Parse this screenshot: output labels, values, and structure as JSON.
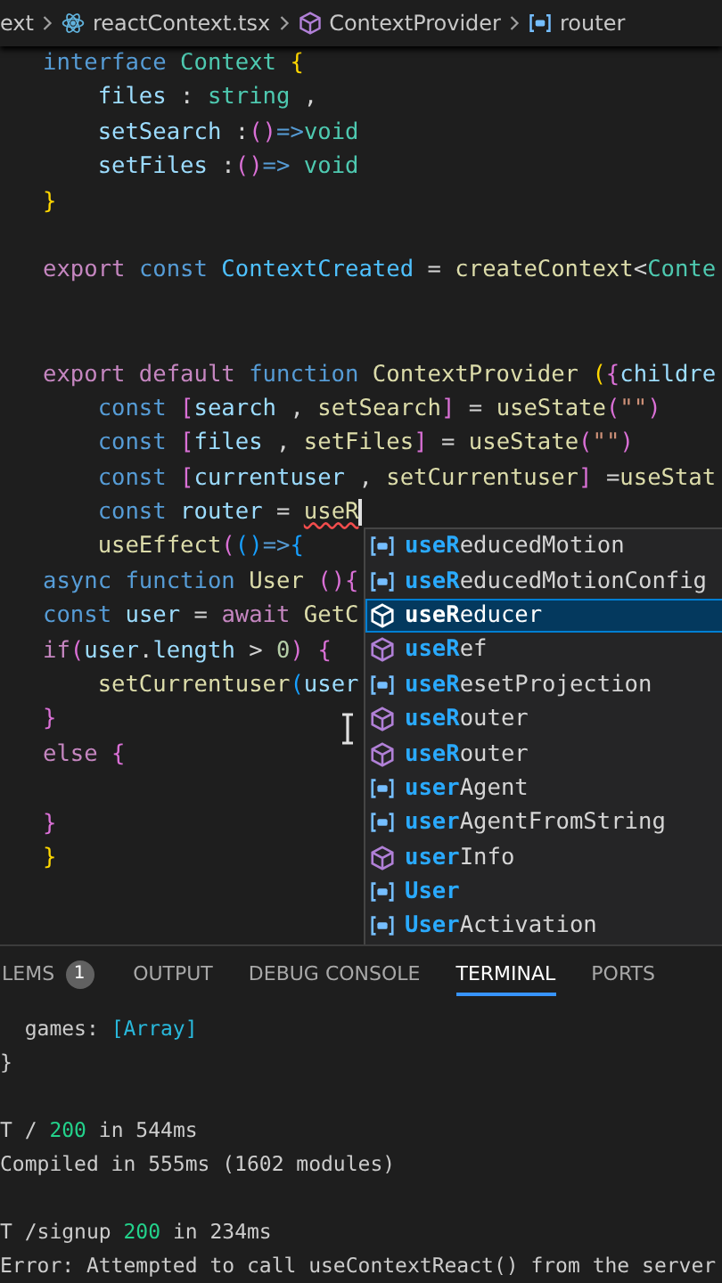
{
  "breadcrumb": [
    {
      "text": "ext",
      "kind": "plain"
    },
    {
      "text": "reactContext.tsx",
      "kind": "file"
    },
    {
      "text": "ContextProvider",
      "kind": "cube"
    },
    {
      "text": "router",
      "kind": "variable"
    }
  ],
  "code_lines": [
    {
      "tokens": [
        {
          "text": "interface ",
          "kind": "kw"
        },
        {
          "text": "Context ",
          "kind": "type"
        },
        {
          "text": "{",
          "kind": "b1"
        }
      ]
    },
    {
      "tokens": [
        {
          "text": "    files",
          "kind": "var"
        },
        {
          "text": " : ",
          "kind": "p"
        },
        {
          "text": "string",
          "kind": "type"
        },
        {
          "text": " ,",
          "kind": "p"
        }
      ]
    },
    {
      "tokens": [
        {
          "text": "    setSearch",
          "kind": "var"
        },
        {
          "text": " :",
          "kind": "p"
        },
        {
          "text": "()",
          "kind": "b2"
        },
        {
          "text": "=>",
          "kind": "kw"
        },
        {
          "text": "void",
          "kind": "type"
        }
      ]
    },
    {
      "tokens": [
        {
          "text": "    setFiles",
          "kind": "var"
        },
        {
          "text": " :",
          "kind": "p"
        },
        {
          "text": "()",
          "kind": "b2"
        },
        {
          "text": "=> ",
          "kind": "kw"
        },
        {
          "text": "void",
          "kind": "type"
        }
      ]
    },
    {
      "tokens": [
        {
          "text": "}",
          "kind": "b1"
        }
      ]
    },
    {
      "kind": "blank"
    },
    {
      "tokens": [
        {
          "text": "export ",
          "kind": "ctrl"
        },
        {
          "text": "const ",
          "kind": "kw"
        },
        {
          "text": "ContextCreated",
          "kind": "const"
        },
        {
          "text": " = ",
          "kind": "p"
        },
        {
          "text": "createContext",
          "kind": "fn"
        },
        {
          "text": "<",
          "kind": "p"
        },
        {
          "text": "Conte",
          "kind": "type"
        }
      ]
    },
    {
      "kind": "blank"
    },
    {
      "kind": "blank"
    },
    {
      "tokens": [
        {
          "text": "export default ",
          "kind": "ctrl"
        },
        {
          "text": "function ",
          "kind": "kw"
        },
        {
          "text": "ContextProvider ",
          "kind": "fn"
        },
        {
          "text": "(",
          "kind": "b1"
        },
        {
          "text": "{",
          "kind": "b2"
        },
        {
          "text": "childre",
          "kind": "var"
        }
      ]
    },
    {
      "tokens": [
        {
          "text": "    const ",
          "kind": "kw"
        },
        {
          "text": "[",
          "kind": "b2"
        },
        {
          "text": "search",
          "kind": "var"
        },
        {
          "text": " , ",
          "kind": "p"
        },
        {
          "text": "setSearch",
          "kind": "fn"
        },
        {
          "text": "]",
          "kind": "b2"
        },
        {
          "text": " = ",
          "kind": "p"
        },
        {
          "text": "useState",
          "kind": "fn"
        },
        {
          "text": "(",
          "kind": "b2"
        },
        {
          "text": "\"\"",
          "kind": "str"
        },
        {
          "text": ")",
          "kind": "b2"
        }
      ]
    },
    {
      "tokens": [
        {
          "text": "    const ",
          "kind": "kw"
        },
        {
          "text": "[",
          "kind": "b2"
        },
        {
          "text": "files",
          "kind": "var"
        },
        {
          "text": " , ",
          "kind": "p"
        },
        {
          "text": "setFiles",
          "kind": "fn"
        },
        {
          "text": "]",
          "kind": "b2"
        },
        {
          "text": " = ",
          "kind": "p"
        },
        {
          "text": "useState",
          "kind": "fn"
        },
        {
          "text": "(",
          "kind": "b2"
        },
        {
          "text": "\"\"",
          "kind": "str"
        },
        {
          "text": ")",
          "kind": "b2"
        }
      ]
    },
    {
      "tokens": [
        {
          "text": "    const ",
          "kind": "kw"
        },
        {
          "text": "[",
          "kind": "b2"
        },
        {
          "text": "currentuser",
          "kind": "var"
        },
        {
          "text": " , ",
          "kind": "p"
        },
        {
          "text": "setCurrentuser",
          "kind": "fn"
        },
        {
          "text": "]",
          "kind": "b2"
        },
        {
          "text": " =",
          "kind": "p"
        },
        {
          "text": "useStat",
          "kind": "fn"
        }
      ]
    },
    {
      "tokens": [
        {
          "text": "    const ",
          "kind": "kw"
        },
        {
          "text": "router",
          "kind": "var"
        },
        {
          "text": " = ",
          "kind": "p"
        },
        {
          "text": "useR",
          "kind": "err"
        }
      ]
    },
    {
      "tokens": [
        {
          "text": "    useEffect",
          "kind": "fn"
        },
        {
          "text": "(",
          "kind": "b2"
        },
        {
          "text": "()",
          "kind": "b3"
        },
        {
          "text": "=>",
          "kind": "kw"
        },
        {
          "text": "{",
          "kind": "b3"
        }
      ]
    },
    {
      "tokens": [
        {
          "text": "async function ",
          "kind": "kw"
        },
        {
          "text": "User ",
          "kind": "fn"
        },
        {
          "text": "()",
          "kind": "b2"
        },
        {
          "text": "{",
          "kind": "b2"
        }
      ]
    },
    {
      "tokens": [
        {
          "text": "const ",
          "kind": "kw"
        },
        {
          "text": "user",
          "kind": "var"
        },
        {
          "text": " = ",
          "kind": "p"
        },
        {
          "text": "await ",
          "kind": "ctrl"
        },
        {
          "text": "GetC",
          "kind": "fn"
        }
      ]
    },
    {
      "tokens": [
        {
          "text": "if",
          "kind": "ctrl"
        },
        {
          "text": "(",
          "kind": "b2"
        },
        {
          "text": "user",
          "kind": "var"
        },
        {
          "text": ".",
          "kind": "p"
        },
        {
          "text": "length",
          "kind": "var"
        },
        {
          "text": " > ",
          "kind": "p"
        },
        {
          "text": "0",
          "kind": "num"
        },
        {
          "text": ")",
          "kind": "b2"
        },
        {
          "text": " {",
          "kind": "b2"
        }
      ]
    },
    {
      "tokens": [
        {
          "text": "    setCurrentuser",
          "kind": "fn"
        },
        {
          "text": "(",
          "kind": "b3"
        },
        {
          "text": "user",
          "kind": "var"
        }
      ]
    },
    {
      "tokens": [
        {
          "text": "}",
          "kind": "b2"
        }
      ]
    },
    {
      "tokens": [
        {
          "text": "else ",
          "kind": "ctrl"
        },
        {
          "text": "{",
          "kind": "b2"
        }
      ]
    },
    {
      "kind": "blank"
    },
    {
      "tokens": [
        {
          "text": "}",
          "kind": "b2"
        }
      ]
    },
    {
      "tokens": [
        {
          "text": "}",
          "kind": "b1"
        }
      ]
    }
  ],
  "suggestions": [
    {
      "match": "useR",
      "rest": "educedMotion",
      "kind": "variable",
      "selected": false
    },
    {
      "match": "useR",
      "rest": "educedMotionConfig",
      "kind": "variable",
      "selected": false
    },
    {
      "match": "useR",
      "rest": "educer",
      "kind": "cube",
      "selected": true
    },
    {
      "match": "useR",
      "rest": "ef",
      "kind": "cube",
      "selected": false
    },
    {
      "match": "useR",
      "rest": "esetProjection",
      "kind": "variable",
      "selected": false
    },
    {
      "match": "useR",
      "rest": "outer",
      "kind": "cube",
      "selected": false
    },
    {
      "match": "useR",
      "rest": "outer",
      "kind": "cube",
      "selected": false
    },
    {
      "match": "user",
      "rest": "Agent",
      "kind": "variable",
      "selected": false
    },
    {
      "match": "user",
      "rest": "AgentFromString",
      "kind": "variable",
      "selected": false
    },
    {
      "match": "user",
      "rest": "Info",
      "kind": "cube",
      "selected": false
    },
    {
      "match": "User",
      "kind": "variable",
      "selected": false
    },
    {
      "match": "User",
      "rest": "Activation",
      "kind": "variable",
      "selected": false
    }
  ],
  "panel": {
    "tabs": [
      {
        "label": "LEMS",
        "badge": "1",
        "selected": false
      },
      {
        "label": "OUTPUT",
        "selected": false
      },
      {
        "label": "DEBUG CONSOLE",
        "selected": false
      },
      {
        "label": "TERMINAL",
        "selected": true
      },
      {
        "label": "PORTS",
        "selected": false
      }
    ],
    "terminal_lines": [
      {
        "tokens": [
          {
            "text": "  games: ",
            "kind": "p"
          },
          {
            "text": "[Array]",
            "kind": "cyan"
          }
        ]
      },
      {
        "tokens": [
          {
            "text": "}",
            "kind": "p"
          }
        ]
      },
      {
        "kind": "blank"
      },
      {
        "tokens": [
          {
            "text": "T / ",
            "kind": "p"
          },
          {
            "text": "200",
            "kind": "green"
          },
          {
            "text": " in 544ms",
            "kind": "p"
          }
        ]
      },
      {
        "tokens": [
          {
            "text": "Compiled in 555ms (1602 modules)",
            "kind": "p"
          }
        ]
      },
      {
        "kind": "blank"
      },
      {
        "tokens": [
          {
            "text": "T /signup ",
            "kind": "p"
          },
          {
            "text": "200",
            "kind": "green"
          },
          {
            "text": " in 234ms",
            "kind": "p"
          }
        ]
      },
      {
        "tokens": [
          {
            "text": "Error: Attempted to call useContextReact() from the server",
            "kind": "p"
          }
        ]
      }
    ]
  }
}
